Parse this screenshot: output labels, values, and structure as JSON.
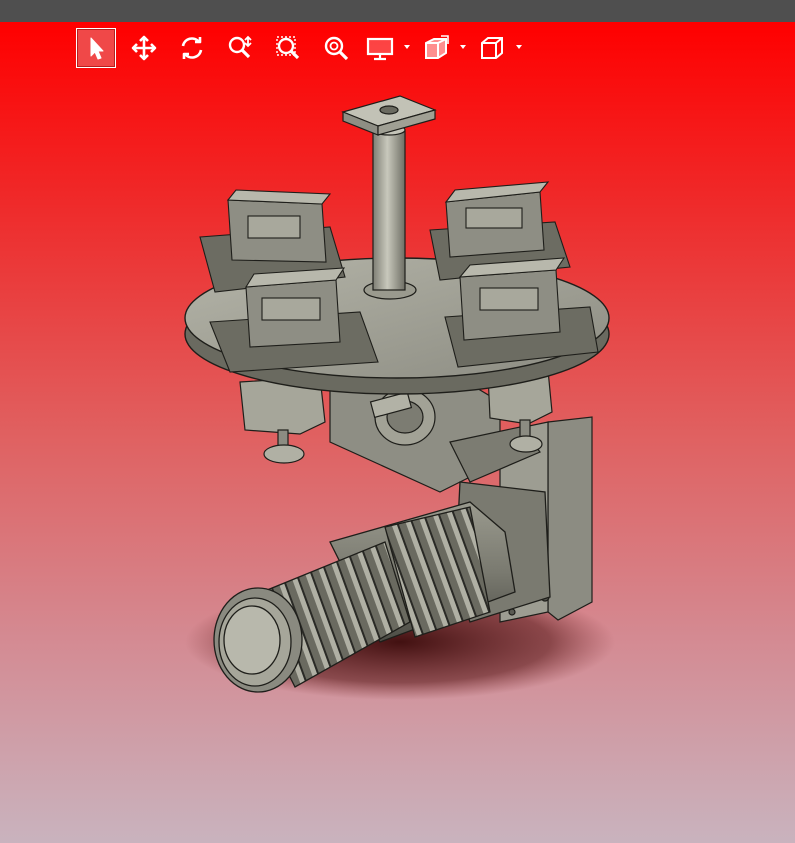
{
  "window": {
    "title_bar_color": "#4f4f4f"
  },
  "viewport": {
    "background_top": "#ff0000",
    "background_bottom": "#c9b3be"
  },
  "toolbar": {
    "tools": [
      {
        "name": "select",
        "icon": "cursor-arrow-icon",
        "active": true
      },
      {
        "name": "pan",
        "icon": "move-arrows-icon",
        "active": false
      },
      {
        "name": "rotate",
        "icon": "rotate-icon",
        "active": false
      },
      {
        "name": "zoom",
        "icon": "zoom-vertical-icon",
        "active": false
      },
      {
        "name": "zoom-window",
        "icon": "zoom-window-icon",
        "active": false
      },
      {
        "name": "zoom-fit",
        "icon": "zoom-fit-icon",
        "active": false
      },
      {
        "name": "display-mode",
        "icon": "monitor-icon",
        "active": false,
        "dropdown": true
      },
      {
        "name": "section-view",
        "icon": "section-cube-icon",
        "active": false,
        "dropdown": true
      },
      {
        "name": "view-orientation",
        "icon": "view-cube-icon",
        "active": false,
        "dropdown": true
      }
    ]
  },
  "model": {
    "part_color": "#a9a99c",
    "edge_color": "#1e1e1a"
  }
}
